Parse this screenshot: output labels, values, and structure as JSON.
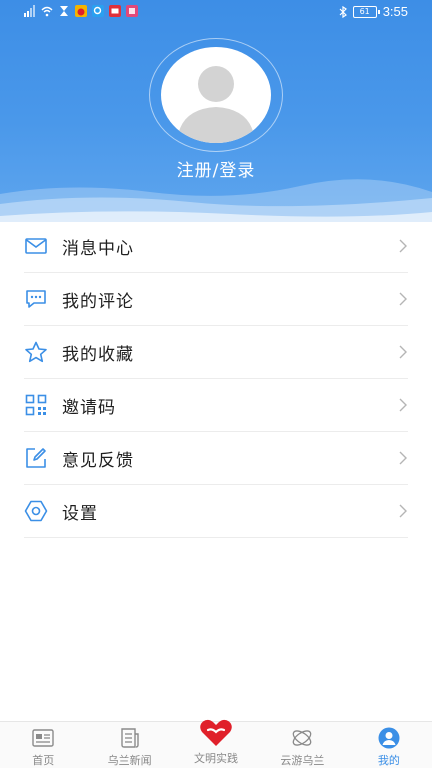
{
  "status_bar": {
    "time": "3:55",
    "battery": "61"
  },
  "profile": {
    "login_label": "注册/登录"
  },
  "menu": [
    {
      "label": "消息中心",
      "icon": "mail-icon"
    },
    {
      "label": "我的评论",
      "icon": "comment-icon"
    },
    {
      "label": "我的收藏",
      "icon": "star-icon"
    },
    {
      "label": "邀请码",
      "icon": "qrcode-icon"
    },
    {
      "label": "意见反馈",
      "icon": "edit-icon"
    },
    {
      "label": "设置",
      "icon": "settings-icon"
    }
  ],
  "tabs": [
    {
      "label": "首页",
      "icon": "home-newspaper-icon"
    },
    {
      "label": "乌兰新闻",
      "icon": "news-icon"
    },
    {
      "label": "文明实践",
      "icon": "heart-icon"
    },
    {
      "label": "云游乌兰",
      "icon": "orbit-icon"
    },
    {
      "label": "我的",
      "icon": "profile-icon",
      "active": true
    }
  ],
  "colors": {
    "accent": "#3b8fe6",
    "header": "#4a98ea",
    "heart": "#e0202a"
  }
}
